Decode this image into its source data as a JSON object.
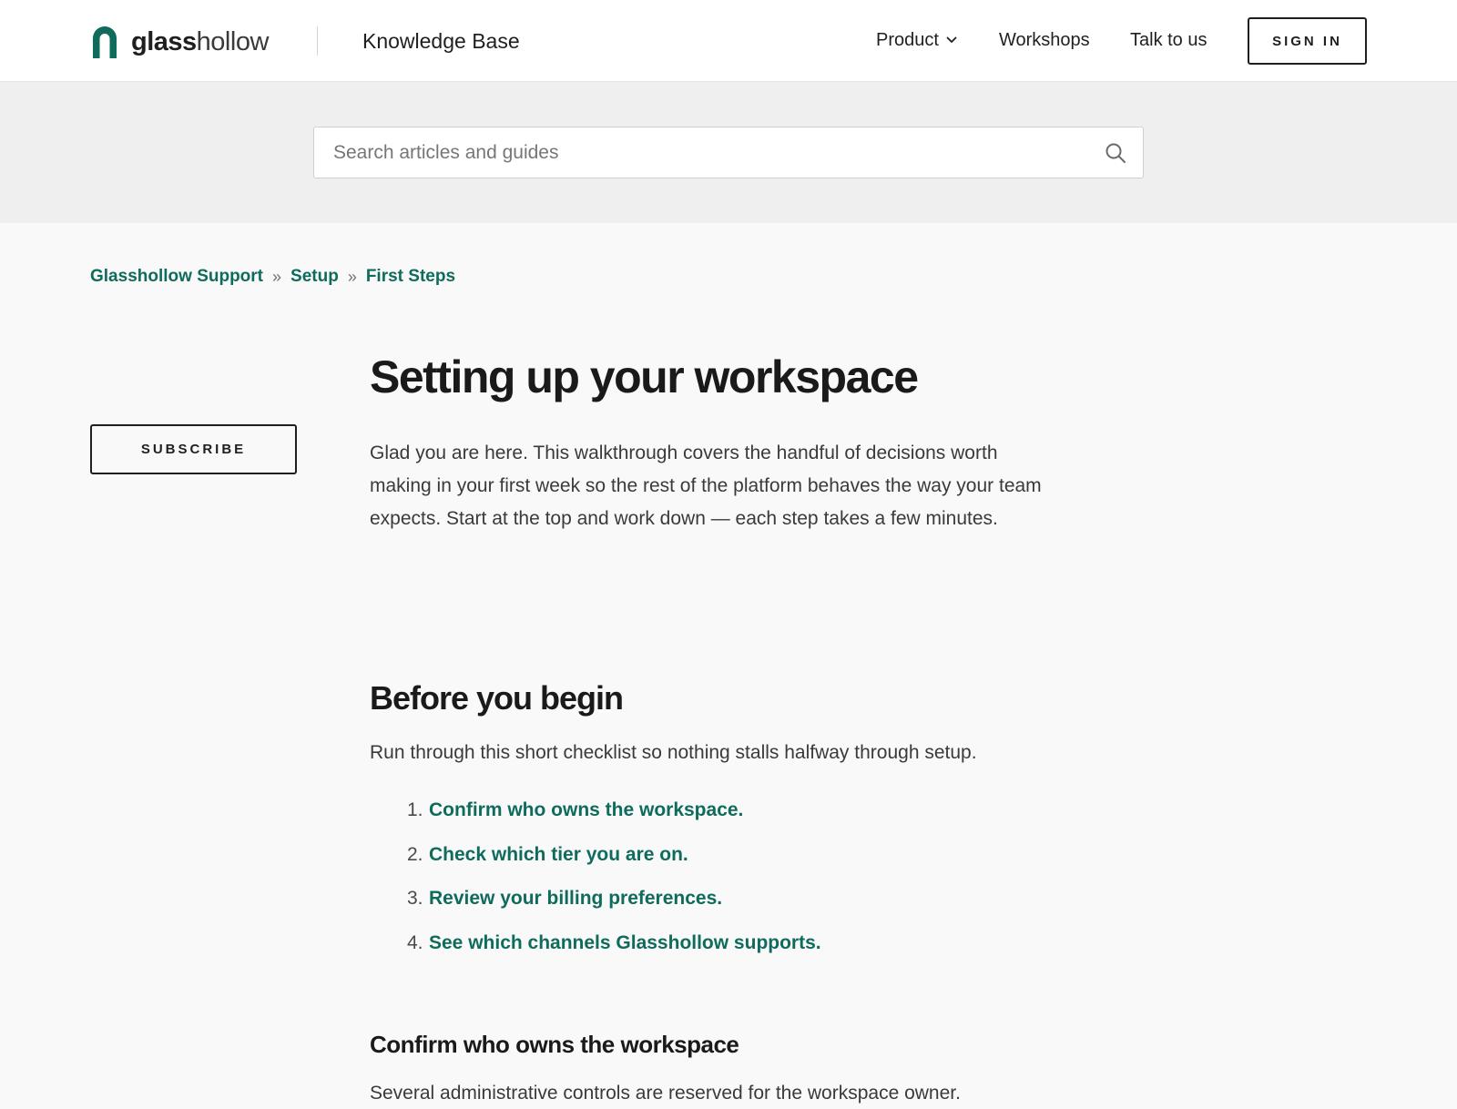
{
  "header": {
    "logo": {
      "bold": "glass",
      "light": "hollow"
    },
    "kb_title": "Knowledge Base",
    "nav": {
      "product": "Product",
      "workshops": "Workshops",
      "talk": "Talk to us"
    },
    "signin_label": "SIGN IN"
  },
  "search": {
    "placeholder": "Search articles and guides",
    "value": ""
  },
  "breadcrumb": [
    "Glasshollow Support",
    "Setup",
    "First Steps"
  ],
  "breadcrumb_separator": "»",
  "sidebar": {
    "subscribe_label": "SUBSCRIBE"
  },
  "article": {
    "title": "Setting up your workspace",
    "intro": "Glad you are here. This walkthrough covers the handful of decisions worth making in your first week so the rest of the platform behaves the way your team expects. Start at the top and work down — each step takes a few minutes.",
    "section_heading": "Before you begin",
    "section_lead": "Run through this short checklist so nothing stalls halfway through setup.",
    "steps": [
      {
        "num": "1.",
        "label": "Confirm who owns the workspace."
      },
      {
        "num": "2.",
        "label": "Check which tier you are on."
      },
      {
        "num": "3.",
        "label": "Review your billing preferences."
      },
      {
        "num": "4.",
        "label": "See which channels Glasshollow supports."
      }
    ],
    "subsection_heading": "Confirm who owns the workspace",
    "subsection_text": "Several administrative controls are reserved for the workspace owner."
  },
  "colors": {
    "accent": "#0f6b5c",
    "text": "#1f1f1f",
    "body_text": "#3a3a3a",
    "page_bg": "#f9f9f9",
    "search_band_bg": "#efefef",
    "header_bg": "#ffffff"
  },
  "icons": {
    "logo_mark": "arch-logo-icon",
    "product_menu": "chevron-down-icon",
    "search": "search-icon"
  }
}
